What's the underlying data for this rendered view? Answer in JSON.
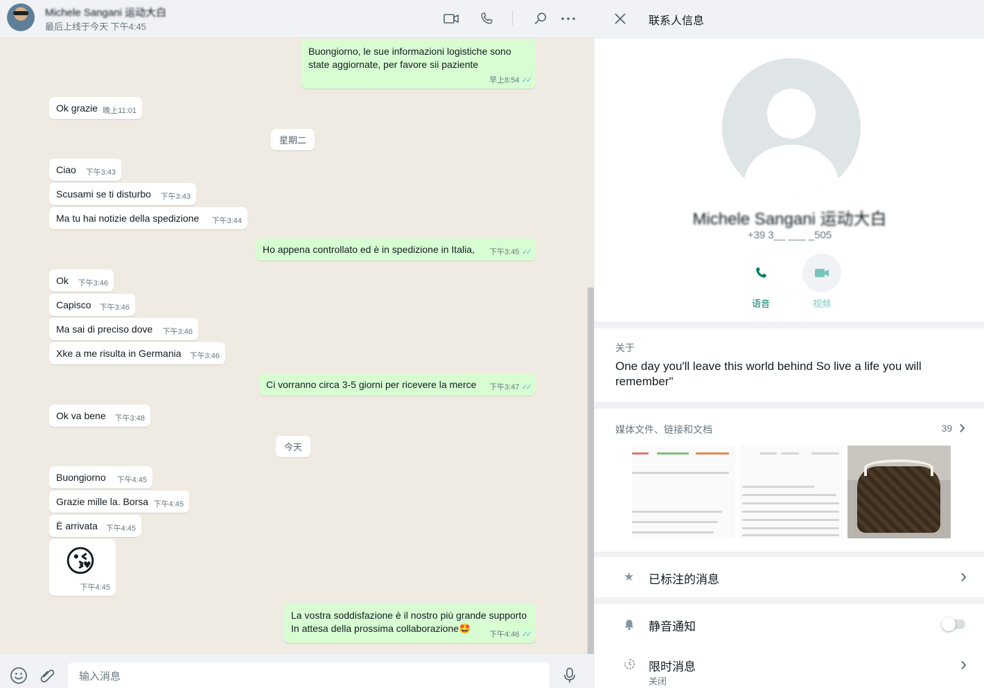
{
  "header": {
    "name": "Michele Sangani 运动大白",
    "status": "最后上线于今天 下午4:45"
  },
  "messages": [
    {
      "dir": "out",
      "lines": [
        "Buongiorno, le sue informazioni logistiche sono",
        "state aggiornate, per favore sii paziente"
      ],
      "time": "早上8:54"
    },
    {
      "dir": "in",
      "text": "Ok grazie",
      "time": "晚上11:01"
    },
    {
      "dir": "in",
      "text": "Ciao",
      "time": "下午3:43"
    },
    {
      "dir": "in",
      "text": "Scusami se ti disturbo",
      "time": "下午3:43"
    },
    {
      "dir": "in",
      "text": "Ma tu hai notizie della spedizione",
      "time": "下午3:44"
    },
    {
      "dir": "out",
      "text": "Ho appena controllato ed è in spedizione in Italia,",
      "time": "下午3:45"
    },
    {
      "dir": "in",
      "text": "Ok",
      "time": "下午3:46"
    },
    {
      "dir": "in",
      "text": "Capisco",
      "time": "下午3:46"
    },
    {
      "dir": "in",
      "text": "Ma sai di preciso dove",
      "time": "下午3:46"
    },
    {
      "dir": "in",
      "text": "Xke a me risulta in Germania",
      "time": "下午3:46"
    },
    {
      "dir": "out",
      "text": "Ci vorranno circa 3-5 giorni per ricevere la merce",
      "time": "下午3:47"
    },
    {
      "dir": "in",
      "text": "Ok va bene",
      "time": "下午3:48"
    },
    {
      "dir": "in",
      "text": "Buongiorno",
      "time": "下午4:45"
    },
    {
      "dir": "in",
      "text": "Grazie mille la. Borsa",
      "time": "下午4:45"
    },
    {
      "dir": "in",
      "text": "È arrivata",
      "time": "下午4:45"
    },
    {
      "dir": "in",
      "text": "😘",
      "time": "下午4:45",
      "emoji": true
    },
    {
      "dir": "out",
      "lines": [
        "La vostra soddisfazione è il nostro più grande supporto",
        "In attesa della prossima collaborazione🤩"
      ],
      "time": "下午4:46"
    }
  ],
  "day_separators": [
    "星期二",
    "今天"
  ],
  "composer": {
    "placeholder": "输入消息"
  },
  "info": {
    "title": "联系人信息",
    "name": "Michele Sangani 运动大白",
    "phone": "+39 3__ ___ _505",
    "actions": [
      {
        "label": "语音",
        "color": "#008069"
      },
      {
        "label": "视频",
        "color": "#7ac5b9"
      }
    ],
    "about_label": "关于",
    "about_text": "One day you'll leave this world behind So live a life you will remember\"",
    "media_label": "媒体文件、链接和文档",
    "media_count": "39",
    "starred_label": "已标注的消息",
    "mute_label": "静音通知",
    "disappearing_label": "限时消息",
    "disappearing_sub": "关闭"
  }
}
